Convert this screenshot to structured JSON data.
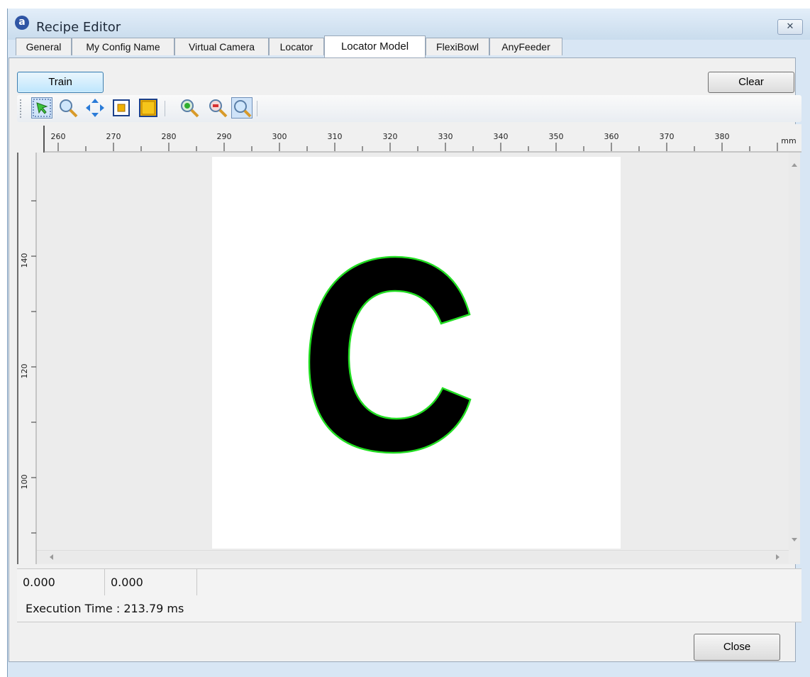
{
  "window": {
    "title": "Recipe Editor",
    "close_glyph": "✕"
  },
  "tabs": [
    {
      "label": "General",
      "active": false
    },
    {
      "label": "My Config Name",
      "active": false
    },
    {
      "label": "Virtual Camera",
      "active": false
    },
    {
      "label": "Locator",
      "active": false
    },
    {
      "label": "Locator Model",
      "active": true
    },
    {
      "label": "FlexiBowl",
      "active": false
    },
    {
      "label": "AnyFeeder",
      "active": false
    }
  ],
  "buttons": {
    "train": "Train",
    "clear": "Clear",
    "close": "Close"
  },
  "toolbar_icons": [
    "select-pointer-icon",
    "zoom-icon",
    "pan-icon",
    "region-small-icon",
    "region-large-icon",
    "zoom-in-icon",
    "zoom-out-icon",
    "zoom-fit-icon"
  ],
  "ruler": {
    "unit": "mm",
    "x_ticks": [
      "260",
      "270",
      "280",
      "290",
      "300",
      "310",
      "320",
      "330",
      "340",
      "350",
      "360",
      "370",
      "380"
    ],
    "y_ticks": [
      "140",
      "120",
      "100"
    ]
  },
  "status": {
    "x_value": "0.000",
    "y_value": "0.000",
    "execution": "Execution Time : 213.79 ms"
  },
  "colors": {
    "contour": "#22dd22",
    "shape": "#000000",
    "accent": "#3c7fb1"
  }
}
